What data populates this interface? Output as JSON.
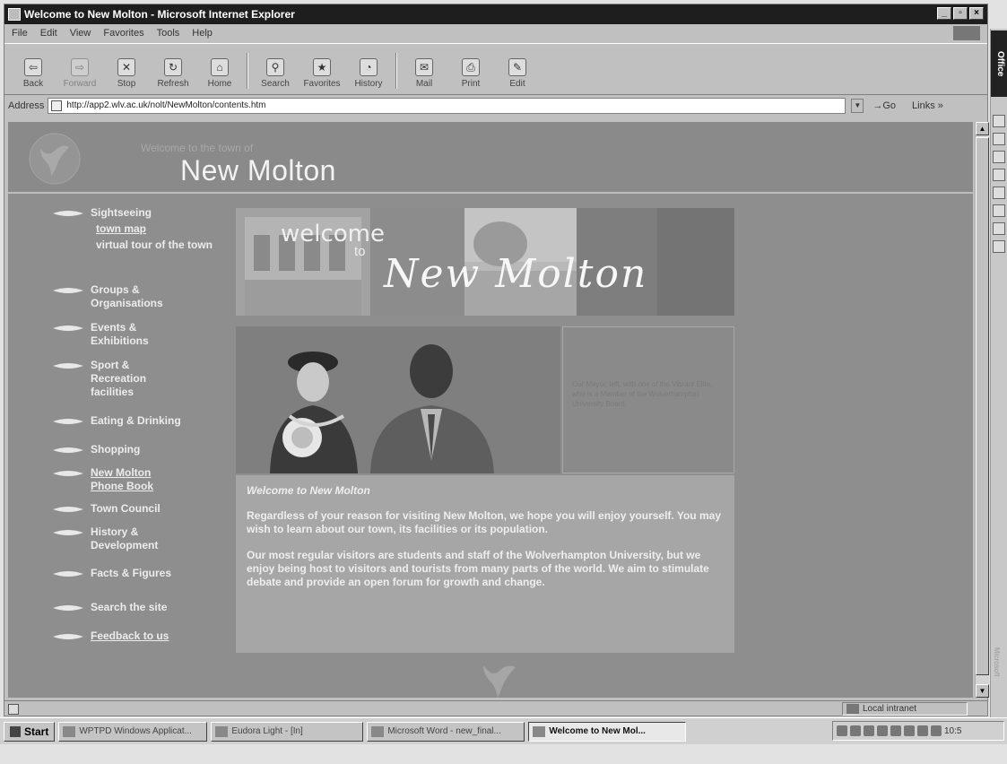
{
  "window": {
    "title": "Welcome to New Molton - Microsoft Internet Explorer",
    "min": "_",
    "max": "▫",
    "close": "×"
  },
  "menu": [
    "File",
    "Edit",
    "View",
    "Favorites",
    "Tools",
    "Help"
  ],
  "toolbar": [
    {
      "label": "Back",
      "icon": "back-arrow-icon",
      "glyph": "⇦"
    },
    {
      "label": "Forward",
      "icon": "forward-arrow-icon",
      "glyph": "⇨"
    },
    {
      "label": "Stop",
      "icon": "stop-icon",
      "glyph": "✕"
    },
    {
      "label": "Refresh",
      "icon": "refresh-icon",
      "glyph": "↻"
    },
    {
      "label": "Home",
      "icon": "home-icon",
      "glyph": "⌂"
    },
    {
      "label": "Search",
      "icon": "search-icon",
      "glyph": "⚲"
    },
    {
      "label": "Favorites",
      "icon": "favorites-icon",
      "glyph": "★"
    },
    {
      "label": "History",
      "icon": "history-icon",
      "glyph": "◔"
    },
    {
      "label": "Mail",
      "icon": "mail-icon",
      "glyph": "✉"
    },
    {
      "label": "Print",
      "icon": "print-icon",
      "glyph": "⎙"
    },
    {
      "label": "Edit",
      "icon": "edit-icon",
      "glyph": "✎"
    }
  ],
  "address": {
    "label": "Address",
    "url": "http://app2.wlv.ac.uk/nolt/NewMolton/contents.htm",
    "go": "Go",
    "links": "Links »"
  },
  "site": {
    "welcome_small": "Welcome to the town of",
    "title": "New Molton"
  },
  "nav": {
    "sightseeing": "Sightseeing",
    "town_map": "town map",
    "virtual_tour": "virtual tour of the town",
    "groups": "Groups & Organisations",
    "events": "Events & Exhibitions",
    "sport": "Sport & Recreation facilities",
    "eating": "Eating & Drinking",
    "shopping": "Shopping",
    "phone_book": "New Molton Phone Book",
    "town_council": "Town Council",
    "history": "History & Development",
    "facts": "Facts & Figures",
    "search": "Search the site",
    "feedback": "Feedback to us"
  },
  "banner": {
    "welcome": "welcome",
    "to": "to",
    "script": "New Molton"
  },
  "side_box": {
    "text": "Our Mayor, left, with one of the Vibrant Elite, who is a Member of the Wolverhampton University Board."
  },
  "welcome_box": {
    "title": "Welcome to New Molton",
    "para1": "Regardless of your reason for visiting New Molton, we hope you will enjoy yourself. You may wish to learn about our town, its facilities or its population.",
    "para2": "Our most regular visitors are students and staff of the Wolverhampton University, but we enjoy being host to visitors and tourists from many parts of the world. We aim to stimulate debate and provide an open forum for growth and change."
  },
  "status": {
    "zone": "Local intranet"
  },
  "office": {
    "label": "Office",
    "ms": "Microsoft"
  },
  "taskbar": {
    "start": "Start",
    "tasks": [
      {
        "label": "WPTPD Windows Applicat...",
        "active": false
      },
      {
        "label": "Eudora Light - [In]",
        "active": false
      },
      {
        "label": "Microsoft Word - new_final...",
        "active": false
      },
      {
        "label": "Welcome to New Mol...",
        "active": true
      }
    ],
    "clock": "10:5"
  }
}
